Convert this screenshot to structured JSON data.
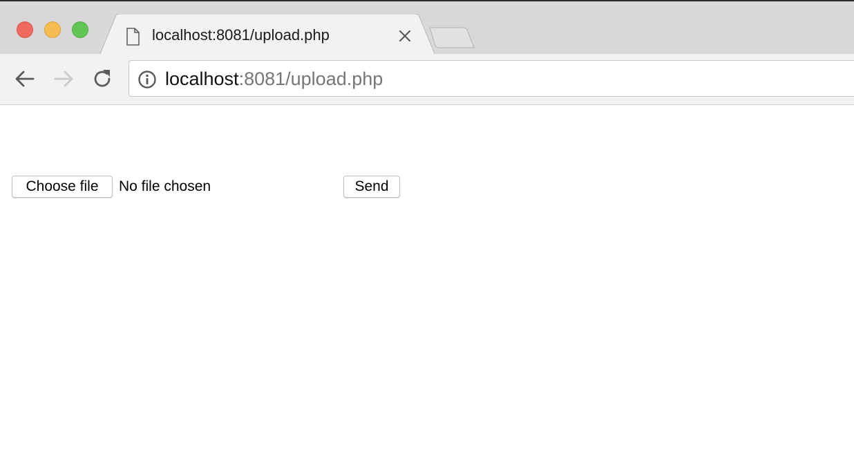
{
  "window": {
    "controls": {
      "close": "#ee6a5e",
      "minimize": "#f5bd4f",
      "maximize": "#61c554"
    }
  },
  "tab": {
    "title": "localhost:8081/upload.php",
    "icon": "page-icon",
    "close_icon": "close-icon"
  },
  "toolbar": {
    "back_icon": "arrow-left-icon",
    "forward_icon": "arrow-right-icon",
    "reload_icon": "reload-icon",
    "info_icon": "info-icon",
    "url_host": "localhost",
    "url_rest": ":8081/upload.php"
  },
  "form": {
    "choose_label": "Choose file",
    "file_status": "No file chosen",
    "send_label": "Send"
  }
}
